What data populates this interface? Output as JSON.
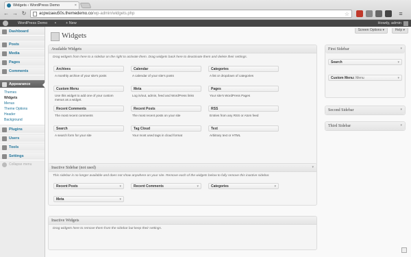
{
  "browser": {
    "tab_title": "Widgets ‹ WordPress Demo",
    "tab_close": "×",
    "url_host": "acpwzaeu50s.themedemo.co",
    "url_path": "/wp-admin/widgets.php"
  },
  "adminbar": {
    "site_name": "WordPress Demo",
    "new_label": "+ New",
    "greeting": "Howdy, admin"
  },
  "sidebar": {
    "items": [
      {
        "label": "Dashboard"
      },
      {
        "label": "Posts"
      },
      {
        "label": "Media"
      },
      {
        "label": "Pages"
      },
      {
        "label": "Comments"
      },
      {
        "label": "Appearance"
      },
      {
        "label": "Plugins"
      },
      {
        "label": "Users"
      },
      {
        "label": "Tools"
      },
      {
        "label": "Settings"
      }
    ],
    "appearance_sub": [
      "Themes",
      "Widgets",
      "Menus",
      "Theme Options",
      "Header",
      "Background"
    ],
    "collapse_label": "Collapse menu"
  },
  "main": {
    "title": "Widgets",
    "screen_options": "Screen Options ▾",
    "help": "Help ▾"
  },
  "available": {
    "heading": "Available Widgets",
    "description": "Drag widgets from here to a sidebar on the right to activate them. Drag widgets back here to deactivate them and delete their settings.",
    "widgets": [
      {
        "name": "Archives",
        "desc": "A monthly archive of your site's posts"
      },
      {
        "name": "Calendar",
        "desc": "A calendar of your site's posts"
      },
      {
        "name": "Categories",
        "desc": "A list or dropdown of categories"
      },
      {
        "name": "Custom Menu",
        "desc": "Use this widget to add one of your custom menus as a widget."
      },
      {
        "name": "Meta",
        "desc": "Log in/out, admin, feed and WordPress links"
      },
      {
        "name": "Pages",
        "desc": "Your site's WordPress Pages"
      },
      {
        "name": "Recent Comments",
        "desc": "The most recent comments"
      },
      {
        "name": "Recent Posts",
        "desc": "The most recent posts on your site"
      },
      {
        "name": "RSS",
        "desc": "Entries from any RSS or Atom feed"
      },
      {
        "name": "Search",
        "desc": "A search form for your site"
      },
      {
        "name": "Tag Cloud",
        "desc": "Your most used tags in cloud format"
      },
      {
        "name": "Text",
        "desc": "Arbitrary text or HTML"
      }
    ]
  },
  "inactive_sidebar": {
    "heading": "Inactive Sidebar (not used)",
    "description": "This sidebar is no longer available and does not show anywhere on your site. Remove each of the widgets below to fully remove this inactive sidebar.",
    "widgets": [
      "Recent Posts",
      "Recent Comments",
      "Categories",
      "Meta"
    ]
  },
  "inactive_widgets": {
    "heading": "Inactive Widgets",
    "description": "Drag widgets here to remove them from the sidebar but keep their settings."
  },
  "sidebars": {
    "first": {
      "heading": "First Sidebar",
      "widgets": [
        {
          "name": "Search",
          "sub": ""
        },
        {
          "name": "Custom Menu:",
          "sub": "Menu"
        }
      ]
    },
    "second": {
      "heading": "Second Sidebar"
    },
    "third": {
      "heading": "Third Sidebar"
    }
  },
  "icons": {
    "arrow": "▾"
  }
}
